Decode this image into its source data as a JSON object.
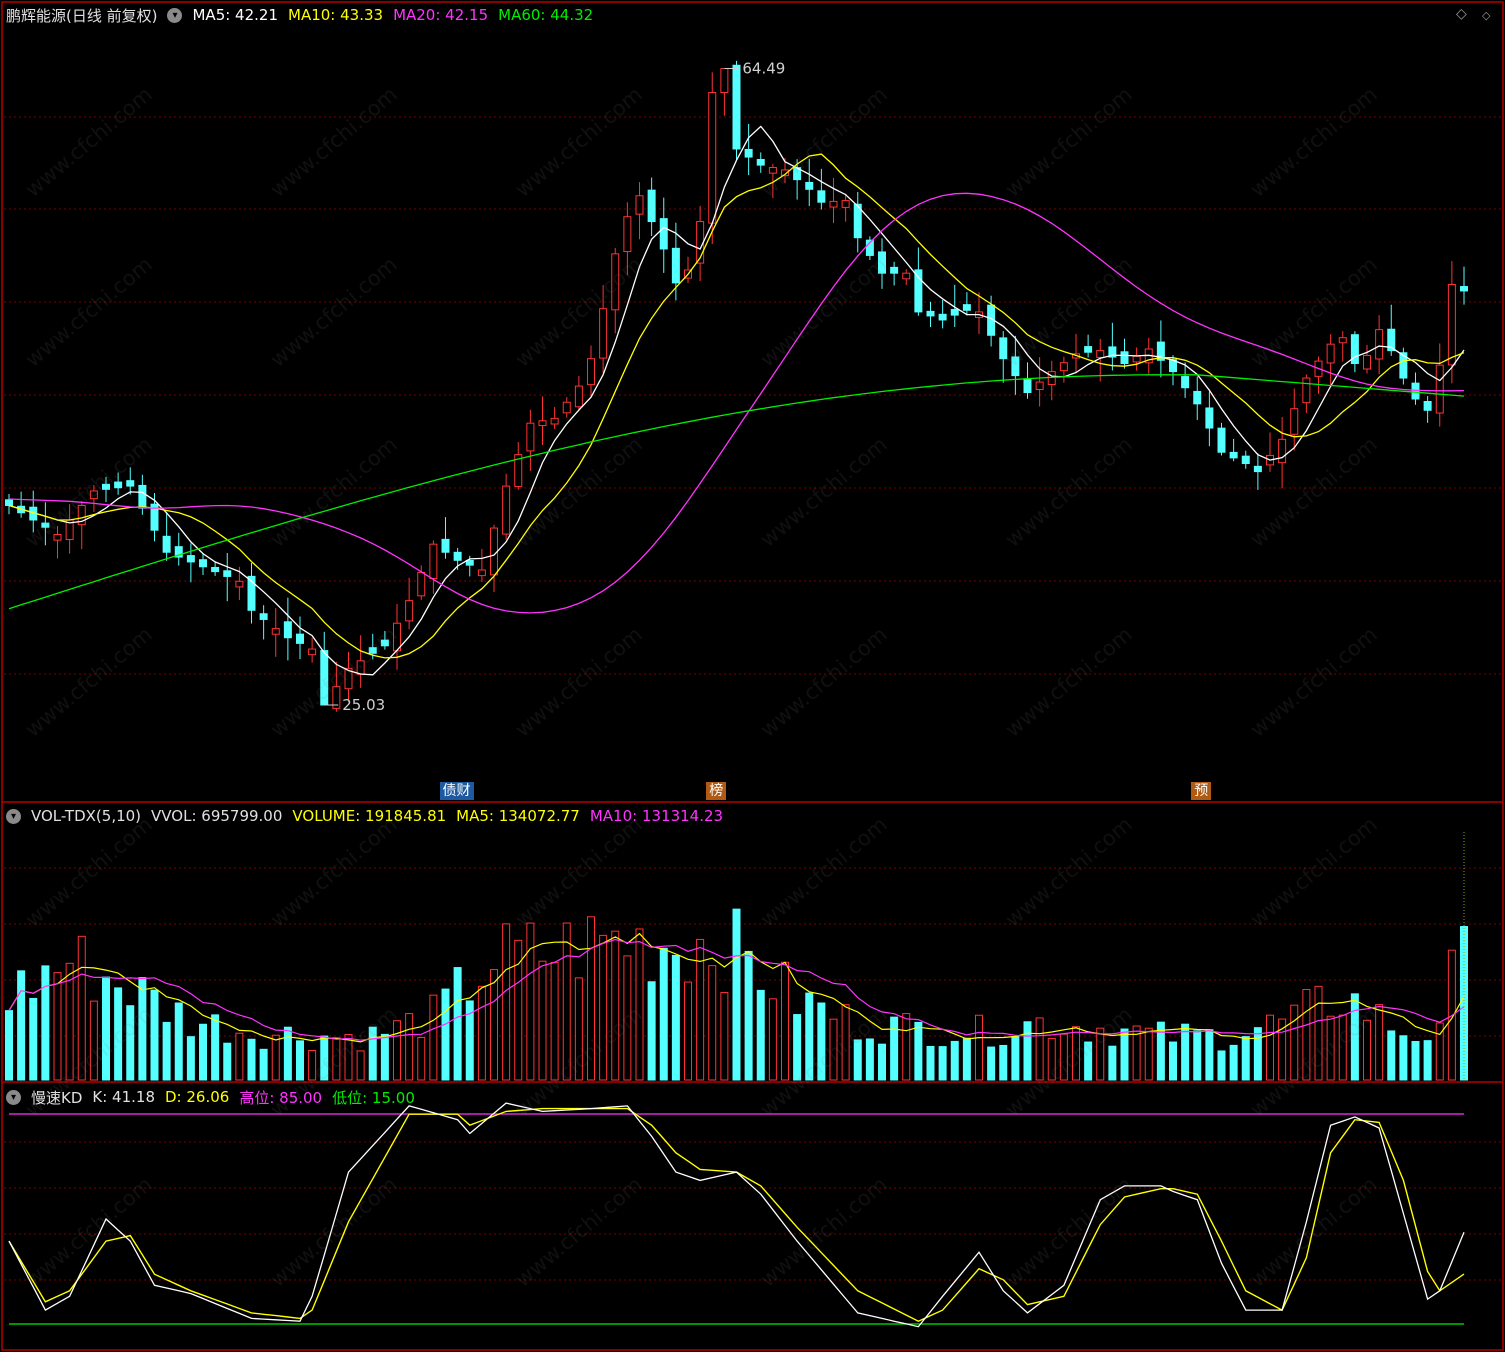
{
  "colors": {
    "ma5": "#ffffff",
    "ma10": "#ffff00",
    "ma20": "#ff33ff",
    "ma60": "#00ee00",
    "up": "#ff3232",
    "down": "#54ffff",
    "grid": "#7a0000",
    "border": "#b40000"
  },
  "main_header": {
    "stock": "鹏辉能源(日线 前复权)",
    "ma5": "MA5: 42.21",
    "ma10": "MA10: 43.33",
    "ma20": "MA20: 42.15",
    "ma60": "MA60: 44.32",
    "menu_icon": "chevron-down-icon",
    "corner_icons": [
      "diamond-icon",
      "diamond-small-icon"
    ]
  },
  "price_high_label": "64.49",
  "price_low_label": "25.03",
  "event_tags": [
    {
      "text": "债财",
      "index": 36,
      "color": "#1e5aa0"
    },
    {
      "text": "榜",
      "index": 58,
      "color": "#b05a14"
    },
    {
      "text": "预",
      "index": 98,
      "color": "#b05a14"
    }
  ],
  "vol_header": {
    "name": "VOL-TDX(5,10)",
    "vvol": "VVOL: 695799.00",
    "volume": "VOLUME: 191845.81",
    "ma5": "MA5: 134072.77",
    "ma10": "MA10: 131314.23"
  },
  "kd_header": {
    "name": "慢速KD",
    "k": "K: 41.18",
    "d": "D: 26.06",
    "high": "高位: 85.00",
    "low": "低位: 15.00"
  },
  "watermark": "www.cfchi.com",
  "chart_data": [
    {
      "type": "candlestick",
      "title": "鹏辉能源(日线 前复权)",
      "ylim": [
        21,
        67
      ],
      "price_points": [
        [
          0,
          37.4
        ],
        [
          4,
          35.6
        ],
        [
          7,
          38.3
        ],
        [
          10,
          38.6
        ],
        [
          13,
          34.5
        ],
        [
          16,
          33.6
        ],
        [
          19,
          32.7
        ],
        [
          20,
          30.9
        ],
        [
          23,
          29.2
        ],
        [
          25,
          28.5
        ],
        [
          26,
          25.03
        ],
        [
          28,
          27.3
        ],
        [
          31,
          28.7
        ],
        [
          33,
          31.5
        ],
        [
          35,
          35.0
        ],
        [
          37,
          34.0
        ],
        [
          39,
          33.4
        ],
        [
          41,
          38.6
        ],
        [
          43,
          42.5
        ],
        [
          45,
          42.8
        ],
        [
          47,
          44.8
        ],
        [
          48,
          46.5
        ],
        [
          49,
          49.6
        ],
        [
          50,
          53.0
        ],
        [
          51,
          55.3
        ],
        [
          52,
          56.6
        ],
        [
          53,
          55.0
        ],
        [
          54,
          53.3
        ],
        [
          55,
          51.2
        ],
        [
          56,
          52.0
        ],
        [
          57,
          55.0
        ],
        [
          58,
          63.0
        ],
        [
          59,
          64.49
        ],
        [
          60,
          59.5
        ],
        [
          62,
          58.5
        ],
        [
          64,
          58.2
        ],
        [
          66,
          57.0
        ],
        [
          67,
          56.2
        ],
        [
          69,
          56.3
        ],
        [
          70,
          54.0
        ],
        [
          72,
          51.8
        ],
        [
          74,
          51.8
        ],
        [
          75,
          49.4
        ],
        [
          77,
          48.9
        ],
        [
          79,
          49.5
        ],
        [
          80,
          49.4
        ],
        [
          82,
          46.5
        ],
        [
          84,
          44.4
        ],
        [
          86,
          45.7
        ],
        [
          88,
          46.8
        ],
        [
          90,
          47.0
        ],
        [
          92,
          46.2
        ],
        [
          94,
          47.1
        ],
        [
          96,
          45.7
        ],
        [
          98,
          43.7
        ],
        [
          100,
          40.7
        ],
        [
          102,
          40.0
        ],
        [
          103,
          39.5
        ],
        [
          105,
          41.5
        ],
        [
          107,
          45.3
        ],
        [
          109,
          47.4
        ],
        [
          110,
          47.8
        ],
        [
          111,
          46.2
        ],
        [
          112,
          46.7
        ],
        [
          113,
          48.3
        ],
        [
          114,
          47.0
        ],
        [
          115,
          45.3
        ],
        [
          116,
          44.0
        ],
        [
          117,
          43.3
        ],
        [
          118,
          46.1
        ],
        [
          119,
          51.1
        ],
        [
          120,
          50.7
        ]
      ],
      "notes": "120 trading days; close path estimated from the chart, individual candles reconstructed"
    },
    {
      "type": "bar",
      "title": "VOL-TDX(5,10)",
      "series": [
        {
          "name": "VOLUME",
          "current": "191845.81"
        },
        {
          "name": "MA5",
          "current": "134072.77"
        },
        {
          "name": "MA10",
          "current": "131314.23"
        }
      ],
      "volume_points": [
        [
          0,
          105000
        ],
        [
          5,
          150000
        ],
        [
          10,
          115000
        ],
        [
          15,
          75000
        ],
        [
          20,
          60000
        ],
        [
          25,
          55000
        ],
        [
          30,
          55000
        ],
        [
          35,
          80000
        ],
        [
          40,
          150000
        ],
        [
          45,
          160000
        ],
        [
          50,
          175000
        ],
        [
          55,
          170000
        ],
        [
          58,
          175000
        ],
        [
          60,
          160000
        ],
        [
          65,
          100000
        ],
        [
          70,
          70000
        ],
        [
          75,
          65000
        ],
        [
          80,
          60000
        ],
        [
          85,
          72000
        ],
        [
          90,
          65000
        ],
        [
          95,
          55000
        ],
        [
          100,
          55000
        ],
        [
          105,
          72000
        ],
        [
          110,
          105000
        ],
        [
          115,
          60000
        ],
        [
          118,
          55000
        ],
        [
          120,
          191845
        ]
      ]
    },
    {
      "type": "line",
      "title": "慢速KD",
      "ylim": [
        0,
        100
      ],
      "thresholds": {
        "high": 85,
        "low": 15
      },
      "series": [
        {
          "name": "K",
          "current": 41.18
        },
        {
          "name": "D",
          "current": 26.06
        }
      ],
      "k_points": [
        [
          0,
          38
        ],
        [
          3,
          13
        ],
        [
          5,
          18
        ],
        [
          8,
          46
        ],
        [
          10,
          38
        ],
        [
          12,
          22
        ],
        [
          15,
          19
        ],
        [
          20,
          10
        ],
        [
          24,
          9
        ],
        [
          25,
          18
        ],
        [
          28,
          63
        ],
        [
          33,
          87
        ],
        [
          37,
          82
        ],
        [
          38,
          77
        ],
        [
          41,
          88
        ],
        [
          44,
          85
        ],
        [
          48,
          86
        ],
        [
          51,
          87
        ],
        [
          53,
          76
        ],
        [
          55,
          63
        ],
        [
          57,
          60
        ],
        [
          60,
          63
        ],
        [
          62,
          55
        ],
        [
          65,
          38
        ],
        [
          70,
          12
        ],
        [
          75,
          7
        ],
        [
          77,
          18
        ],
        [
          80,
          34
        ],
        [
          82,
          20
        ],
        [
          84,
          12
        ],
        [
          87,
          22
        ],
        [
          90,
          53
        ],
        [
          92,
          58
        ],
        [
          95,
          58
        ],
        [
          96,
          56
        ],
        [
          98,
          53
        ],
        [
          100,
          30
        ],
        [
          102,
          13
        ],
        [
          105,
          13
        ],
        [
          107,
          45
        ],
        [
          109,
          80
        ],
        [
          111,
          83
        ],
        [
          113,
          79
        ],
        [
          115,
          48
        ],
        [
          117,
          17
        ],
        [
          118,
          20
        ],
        [
          120,
          41.18
        ]
      ],
      "d_points": [
        [
          0,
          38
        ],
        [
          3,
          16
        ],
        [
          5,
          20
        ],
        [
          8,
          38
        ],
        [
          10,
          40
        ],
        [
          12,
          26
        ],
        [
          15,
          20
        ],
        [
          20,
          12
        ],
        [
          24,
          10
        ],
        [
          25,
          13
        ],
        [
          28,
          45
        ],
        [
          33,
          84
        ],
        [
          37,
          84
        ],
        [
          38,
          80
        ],
        [
          41,
          85
        ],
        [
          44,
          86
        ],
        [
          48,
          86
        ],
        [
          51,
          86
        ],
        [
          53,
          80
        ],
        [
          55,
          70
        ],
        [
          57,
          64
        ],
        [
          60,
          63
        ],
        [
          62,
          58
        ],
        [
          65,
          43
        ],
        [
          70,
          20
        ],
        [
          75,
          9
        ],
        [
          77,
          13
        ],
        [
          80,
          28
        ],
        [
          82,
          24
        ],
        [
          84,
          15
        ],
        [
          87,
          18
        ],
        [
          90,
          44
        ],
        [
          92,
          54
        ],
        [
          95,
          57
        ],
        [
          96,
          57
        ],
        [
          98,
          55
        ],
        [
          100,
          38
        ],
        [
          102,
          20
        ],
        [
          105,
          13
        ],
        [
          107,
          32
        ],
        [
          109,
          70
        ],
        [
          111,
          82
        ],
        [
          113,
          81
        ],
        [
          115,
          60
        ],
        [
          117,
          27
        ],
        [
          118,
          20
        ],
        [
          120,
          26.06
        ]
      ]
    }
  ]
}
